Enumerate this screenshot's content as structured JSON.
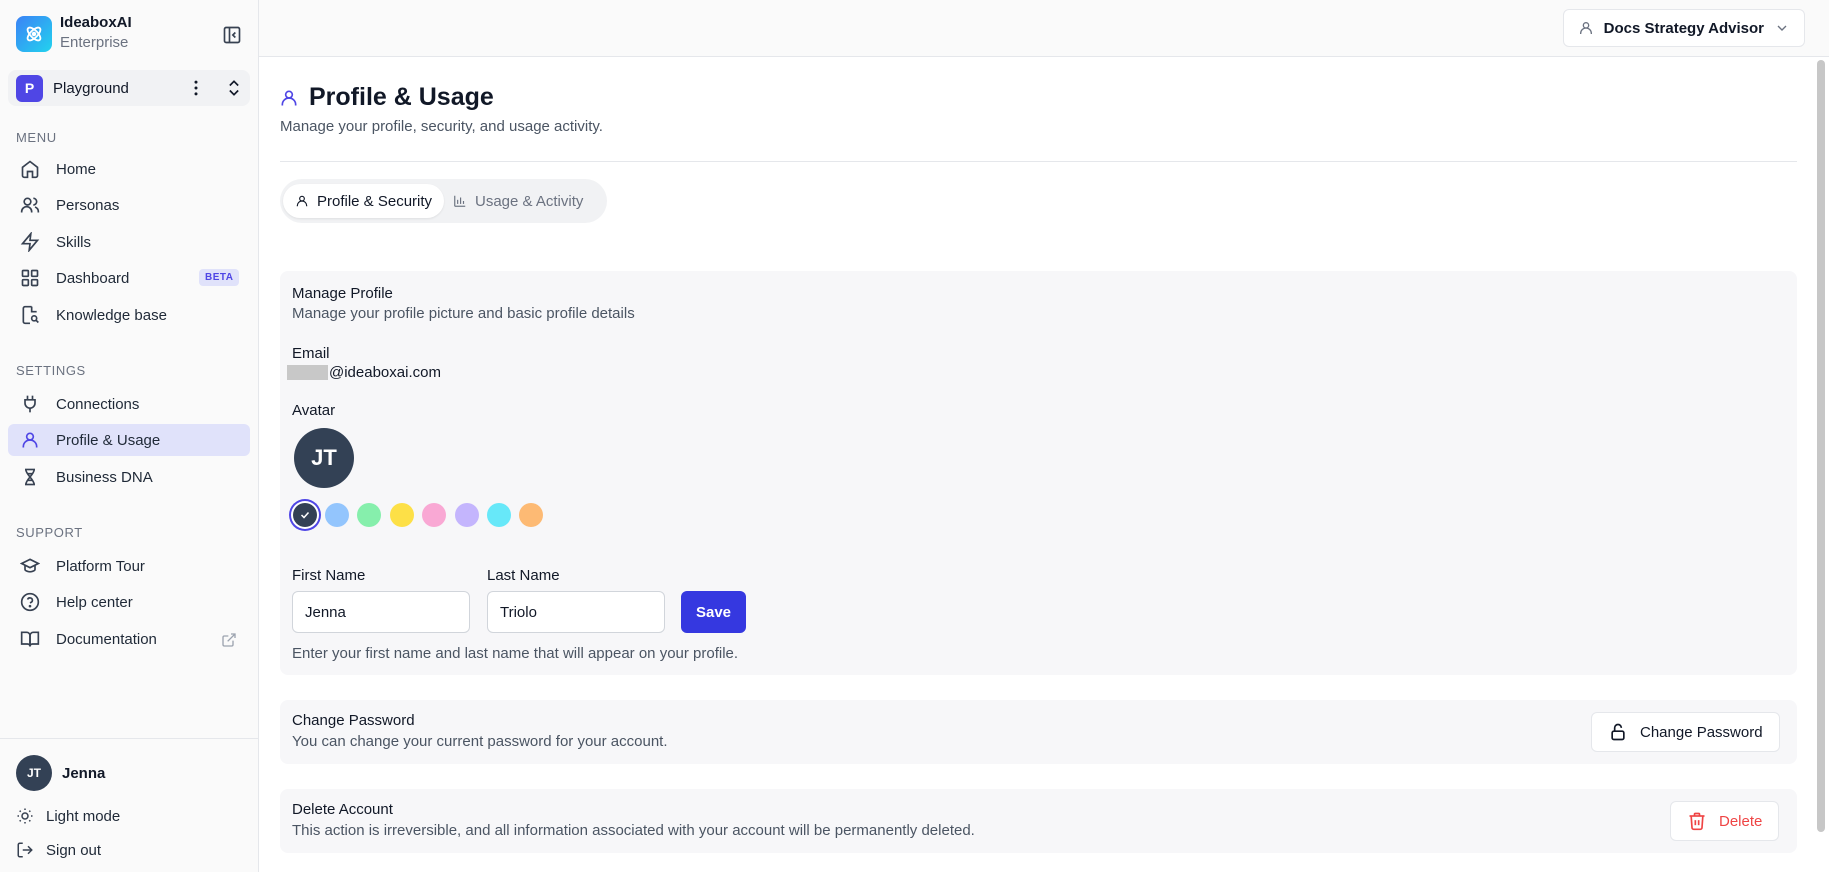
{
  "brand": {
    "name": "IdeaboxAI",
    "plan": "Enterprise"
  },
  "workspace": {
    "initial": "P",
    "name": "Playground"
  },
  "sidebar": {
    "menu_label": "MENU",
    "menu_items": [
      {
        "label": "Home",
        "icon": "home-icon"
      },
      {
        "label": "Personas",
        "icon": "users-icon"
      },
      {
        "label": "Skills",
        "icon": "zap-icon"
      },
      {
        "label": "Dashboard",
        "icon": "grid-icon",
        "badge": "BETA"
      },
      {
        "label": "Knowledge base",
        "icon": "book-search-icon"
      }
    ],
    "settings_label": "SETTINGS",
    "settings_items": [
      {
        "label": "Connections",
        "icon": "plug-icon"
      },
      {
        "label": "Profile & Usage",
        "icon": "user-icon"
      },
      {
        "label": "Business DNA",
        "icon": "dna-icon"
      }
    ],
    "support_label": "SUPPORT",
    "support_items": [
      {
        "label": "Platform Tour",
        "icon": "graduation-cap-icon"
      },
      {
        "label": "Help center",
        "icon": "help-circle-icon"
      },
      {
        "label": "Documentation",
        "icon": "book-open-icon"
      }
    ]
  },
  "user": {
    "initials": "JT",
    "name": "Jenna"
  },
  "bottom_actions": {
    "theme": "Light mode",
    "signout": "Sign out"
  },
  "topbar": {
    "persona": "Docs Strategy Advisor"
  },
  "page": {
    "title": "Profile & Usage",
    "subtitle": "Manage your profile, security, and usage activity."
  },
  "tabs": [
    {
      "label": "Profile & Security",
      "active": true
    },
    {
      "label": "Usage & Activity",
      "active": false
    }
  ],
  "profile": {
    "title": "Manage Profile",
    "description": "Manage your profile picture and basic profile details",
    "email_label": "Email",
    "email_domain": "@ideaboxai.com",
    "avatar_label": "Avatar",
    "avatar_initials": "JT",
    "avatar_colors": [
      "#334155",
      "#93c5fd",
      "#86efac",
      "#fde047",
      "#f9a8d4",
      "#c4b5fd",
      "#67e8f9",
      "#fdba74"
    ],
    "selected_color": "#334155",
    "first_name_label": "First Name",
    "first_name": "Jenna",
    "last_name_label": "Last Name",
    "last_name": "Triolo",
    "save_label": "Save",
    "hint": "Enter your first name and last name that will appear on your profile."
  },
  "password": {
    "title": "Change Password",
    "description": "You can change your current password for your account.",
    "button": "Change Password"
  },
  "delete_account": {
    "title": "Delete Account",
    "description": "This action is irreversible, and all information associated with your account will be permanently deleted.",
    "button": "Delete"
  },
  "colors": {
    "accent": "#3538e0",
    "danger": "#ef4444",
    "active_nav": "#e0e2fa"
  }
}
